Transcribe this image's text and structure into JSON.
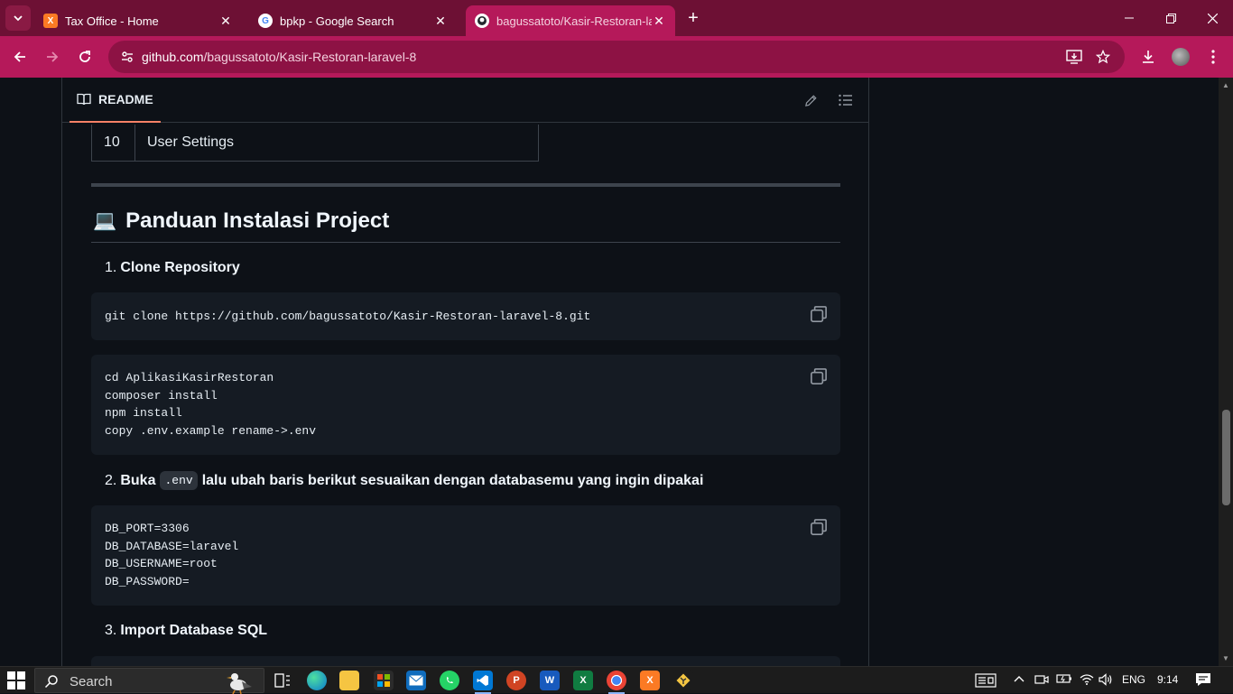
{
  "browser": {
    "tabs": [
      {
        "title": "Tax Office - Home",
        "favicon": "xampp-icon",
        "active": false
      },
      {
        "title": "bpkp - Google Search",
        "favicon": "google-icon",
        "active": false
      },
      {
        "title": "bagussatoto/Kasir-Restoran-laravel-8",
        "favicon": "github-icon",
        "active": true
      }
    ],
    "new_tab": "+",
    "url_host": "github.com",
    "url_path": "/bagussatoto/Kasir-Restoran-laravel-8",
    "accent_color": "#b5195a"
  },
  "readme": {
    "tab_label": "README",
    "table_row": {
      "num": "10",
      "label": "User Settings"
    },
    "heading_icon": "💻",
    "heading": "Panduan Instalasi Project",
    "step1": {
      "num": "1.",
      "label": "Clone Repository"
    },
    "code1": "git clone https://github.com/bagussatoto/Kasir-Restoran-laravel-8.git",
    "code2": "cd AplikasiKasirRestoran\ncomposer install\nnpm install\ncopy .env.example rename->.env",
    "step2": {
      "num": "2.",
      "label_before": "Buka",
      "inline_code": ".env",
      "label_after": "lalu ubah baris berikut sesuaikan dengan databasemu yang ingin dipakai"
    },
    "code3": "DB_PORT=3306\nDB_DATABASE=laravel\nDB_USERNAME=root\nDB_PASSWORD=",
    "step3": {
      "num": "3.",
      "label": "Import Database SQL"
    }
  },
  "taskbar": {
    "search_placeholder": "Search",
    "language": "ENG",
    "time": "9:14"
  }
}
